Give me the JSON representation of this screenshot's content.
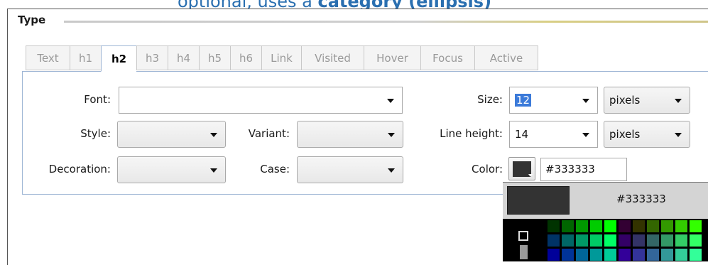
{
  "section": {
    "title": "Type"
  },
  "tabs": [
    {
      "label": "Text",
      "active": false
    },
    {
      "label": "h1",
      "active": false
    },
    {
      "label": "h2",
      "active": true
    },
    {
      "label": "h3",
      "active": false
    },
    {
      "label": "h4",
      "active": false
    },
    {
      "label": "h5",
      "active": false
    },
    {
      "label": "h6",
      "active": false
    },
    {
      "label": "Link",
      "active": false
    },
    {
      "label": "Visited",
      "active": false
    },
    {
      "label": "Hover",
      "active": false
    },
    {
      "label": "Focus",
      "active": false
    },
    {
      "label": "Active",
      "active": false
    }
  ],
  "fields": {
    "font": {
      "label": "Font:",
      "value": ""
    },
    "style": {
      "label": "Style:",
      "value": ""
    },
    "variant": {
      "label": "Variant:",
      "value": ""
    },
    "decoration": {
      "label": "Decoration:",
      "value": ""
    },
    "case": {
      "label": "Case:",
      "value": ""
    },
    "size": {
      "label": "Size:",
      "value": "12",
      "unit": "pixels"
    },
    "line_height": {
      "label": "Line height:",
      "value": "14",
      "unit": "pixels"
    },
    "color": {
      "label": "Color:",
      "value": "#333333"
    }
  },
  "color_picker": {
    "hex": "#333333",
    "swatch_color": "#333333"
  }
}
